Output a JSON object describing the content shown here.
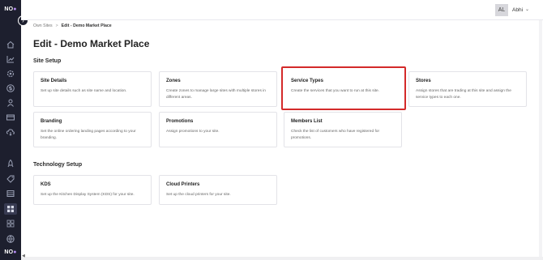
{
  "brand": {
    "logo_text": "NO",
    "logo_suffix": "●"
  },
  "sidebar": {
    "collapse_icon": "chevron-right-icon",
    "icons": [
      {
        "name": "home-icon",
        "active": false
      },
      {
        "name": "analytics-icon",
        "active": false
      },
      {
        "name": "settings-gear-icon",
        "active": false
      },
      {
        "name": "dollar-icon",
        "active": false
      },
      {
        "name": "user-icon",
        "active": false
      },
      {
        "name": "card-icon",
        "active": false
      },
      {
        "name": "cloud-download-icon",
        "active": false
      },
      {
        "name": "rocket-icon",
        "active": false
      },
      {
        "name": "tag-icon",
        "active": false
      },
      {
        "name": "table-icon",
        "active": false
      },
      {
        "name": "grid-icon",
        "active": true
      },
      {
        "name": "apps-icon",
        "active": false
      },
      {
        "name": "globe-icon",
        "active": false
      }
    ]
  },
  "topbar": {
    "avatar_initials": "AL",
    "user_name": "Abhi"
  },
  "breadcrumb": {
    "root": "Own Sites",
    "separator": ">",
    "current": "Edit - Demo Market Place"
  },
  "page": {
    "title": "Edit - Demo Market Place"
  },
  "sections": [
    {
      "title": "Site Setup",
      "cards": [
        {
          "title": "Site Details",
          "desc": "Set up site details such as site name and location.",
          "selected": false
        },
        {
          "title": "Zones",
          "desc": "Create zones to manage large sites with multiple stores in different areas.",
          "selected": false
        },
        {
          "title": "Service Types",
          "desc": "Create the services that you want to run at this site.",
          "selected": true
        },
        {
          "title": "Stores",
          "desc": "Assign stores that are trading at this site and assign the service types to each one.",
          "selected": false
        },
        {
          "title": "Branding",
          "desc": "Set the online ordering landing pages according to your branding.",
          "selected": false
        },
        {
          "title": "Promotions",
          "desc": "Assign promotions to your site.",
          "selected": false
        },
        {
          "title": "Members List",
          "desc": "Check the list of customers who have registered for promotions.",
          "selected": false
        }
      ]
    },
    {
      "title": "Technology Setup",
      "cards": [
        {
          "title": "KDS",
          "desc": "Set up the Kitchen Display System (KDS) for your site.",
          "selected": false
        },
        {
          "title": "Cloud Printers",
          "desc": "Set up the cloud printers for your site.",
          "selected": false
        }
      ]
    }
  ],
  "colors": {
    "sidebar_bg": "#1d1f2e",
    "selection_border": "#d42a2a",
    "accent": "#b58cf0"
  }
}
